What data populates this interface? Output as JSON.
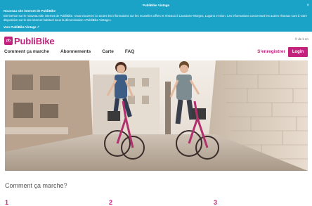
{
  "notice": {
    "title": "PubliBike Vintage",
    "close": "×",
    "heading": "Nouveau site internet de PubliBike",
    "text": "Bienvenue sur le nouveau site internet de PubliBike. Vous trouverez ici toutes les informations sur les nouvelles offres et réseaux à Lausanne-Morges, Lugano et Sion. Les informations concernant les autres réseaux sont à votre disposition sur le site internet habituel sous la dénomination «PubliBike Vintage».",
    "link": "Vers PubliBike Vintage ↗"
  },
  "header": {
    "logo_mark": "pb",
    "logo_text": "PubliBike",
    "lang": "fr de it en"
  },
  "nav": {
    "items": [
      {
        "label": "Comment ça marche"
      },
      {
        "label": "Abonnements"
      },
      {
        "label": "Carte"
      },
      {
        "label": "FAQ"
      }
    ],
    "signup": "S'enregistrer",
    "login": "Login"
  },
  "hero": {
    "alt": "Deux cyclistes sur des vélos PubliBike dans une rue en pente"
  },
  "section": {
    "title": "Comment ça marche?",
    "steps": [
      "1",
      "2",
      "3"
    ]
  },
  "colors": {
    "brand": "#c3227c",
    "notice_bg": "#1aa3c7"
  }
}
